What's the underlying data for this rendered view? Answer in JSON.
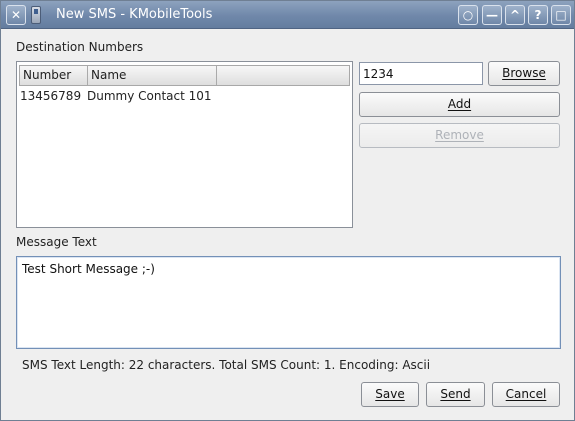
{
  "window": {
    "title": "New SMS - KMobileTools",
    "close_glyph": "✕",
    "sticky_glyph": "○",
    "minimize_glyph": "—",
    "maximize_glyph": "^",
    "help_glyph": "?",
    "restore_glyph": "□"
  },
  "destination": {
    "label": "Destination Numbers",
    "columns": [
      "Number",
      "Name"
    ],
    "rows": [
      {
        "number": "13456789",
        "name": "Dummy Contact 101"
      }
    ]
  },
  "number_input": {
    "value": "1234"
  },
  "buttons": {
    "browse": "Browse",
    "add": "Add",
    "remove": "Remove",
    "save": "Save",
    "send": "Send",
    "cancel": "Cancel"
  },
  "message": {
    "label": "Message Text",
    "text": "Test Short Message ;-)"
  },
  "status": {
    "text": "SMS Text Length: 22 characters. Total SMS Count: 1. Encoding: Ascii"
  },
  "icons": {
    "app": "phone-icon",
    "close": "close-icon",
    "sticky": "sticky-icon",
    "minimize": "minimize-icon",
    "maximize": "maximize-icon",
    "help": "help-icon",
    "restore": "restore-icon"
  },
  "colors": {
    "titlebar": "#7088aa",
    "window_bg": "#efefef",
    "focus_border": "#7390b7"
  }
}
